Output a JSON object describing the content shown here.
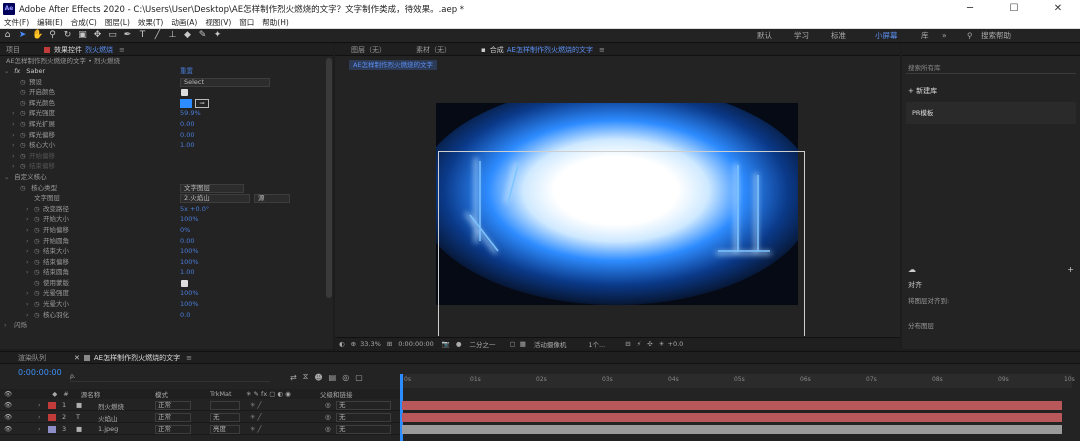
{
  "titlebar": {
    "app_icon": "Ae",
    "title": "Adobe After Effects 2020 - C:\\Users\\User\\Desktop\\AE怎样制作烈火燃烧的文字？文字制作类成，待效果。.aep *",
    "min": "─",
    "max": "☐",
    "close": "✕"
  },
  "menu": [
    "文件(F)",
    "编辑(E)",
    "合成(C)",
    "图层(L)",
    "效果(T)",
    "动画(A)",
    "视图(V)",
    "窗口",
    "帮助(H)"
  ],
  "workspaces": [
    "默认",
    "学习",
    "标准",
    "小屏幕",
    "库"
  ],
  "search_placeholder": "搜索帮助",
  "effects_panel": {
    "tab_project": "项目",
    "tab_effects": "效果控件",
    "tab_effects_target": "烈火燃烧",
    "breadcrumb": "AE怎样制作烈火燃烧的文字 • 烈火燃烧",
    "effect_name": "Saber",
    "reset": "重置",
    "rows": [
      {
        "label": "预设",
        "value": "Select",
        "kind": "dropdown"
      },
      {
        "label": "开启颜色",
        "value": "",
        "kind": "check"
      },
      {
        "label": "辉光颜色",
        "value": "",
        "kind": "color"
      },
      {
        "label": "辉光强度",
        "value": "59.9%",
        "kind": "value"
      },
      {
        "label": "辉光扩展",
        "value": "0.00",
        "kind": "value"
      },
      {
        "label": "辉光偏移",
        "value": "0.00",
        "kind": "value"
      },
      {
        "label": "核心大小",
        "value": "1.00",
        "kind": "value"
      },
      {
        "label": "开始偏移",
        "value": "",
        "kind": "dim"
      },
      {
        "label": "结束偏移",
        "value": "",
        "kind": "dim"
      }
    ],
    "section_custom": "自定义核心",
    "core_type_label": "核心类型",
    "core_type_value": "文字图层",
    "text_layer_label": "文字图层",
    "text_layer_value": "2.火焰山",
    "text_layer_src": "源",
    "rows2": [
      {
        "label": "改变路径",
        "value": "5x +0.0°"
      },
      {
        "label": "开始大小",
        "value": "100%"
      },
      {
        "label": "开始偏移",
        "value": "0%"
      },
      {
        "label": "开始圆角",
        "value": "0.00"
      },
      {
        "label": "结束大小",
        "value": "100%"
      },
      {
        "label": "结束偏移",
        "value": "100%"
      },
      {
        "label": "结束圆角",
        "value": "1.00"
      },
      {
        "label": "使用蒙版",
        "value": "",
        "check": true
      },
      {
        "label": "光晕强度",
        "value": "100%"
      },
      {
        "label": "光晕大小",
        "value": "100%"
      },
      {
        "label": "核心羽化",
        "value": "0.0"
      }
    ],
    "bottom": "闪烁"
  },
  "viewer": {
    "tab_layer": "图层（无）",
    "tab_footage": "素材（无）",
    "tab_comp": "合成",
    "tab_comp_name": "AE怎样制作烈火燃烧的文字",
    "comp_chip": "AE怎样制作烈火燃烧的文字",
    "footer": {
      "zoom": "33.3%",
      "timecode": "0:00:00:00",
      "resolution": "二分之一",
      "camera": "活动摄像机",
      "views": "1个...",
      "offset": "+0.0"
    }
  },
  "right_panel": {
    "search_placeholder": "搜索所有库",
    "new_lib": "+ 新建库",
    "lib_item": "PR模板",
    "lower_title": "对齐",
    "lower_1": "将图层对齐到:",
    "lower_2": "分布图层"
  },
  "timeline": {
    "tab_render": "渲染队列",
    "tab_comp": "AE怎样制作烈火燃烧的文字",
    "timecode": "0:00:00:00",
    "search_placeholder": "ρ.",
    "cols": {
      "source": "源名称",
      "mode": "模式",
      "trkmat": "TrkMat",
      "parent": "父级和链接"
    },
    "layers": [
      {
        "num": "1",
        "name": "烈火燃烧",
        "mode": "正常",
        "trk": "",
        "parent": "无",
        "color": "#c23b3b"
      },
      {
        "num": "2",
        "name": "火焰山",
        "mode": "正常",
        "trk": "无",
        "parent": "无",
        "color": "#c23b3b"
      },
      {
        "num": "3",
        "name": "1.jpeg",
        "mode": "正常",
        "trk": "亮度",
        "parent": "无",
        "color": "#8d8dc8"
      }
    ],
    "ruler": [
      "0s",
      "01s",
      "02s",
      "03s",
      "04s",
      "05s",
      "06s",
      "07s",
      "08s",
      "09s",
      "10s"
    ]
  },
  "colors": {
    "accent": "#2d8cff",
    "layer_bar": "#b9585b",
    "layer_bar3": "#9b9b9b"
  }
}
